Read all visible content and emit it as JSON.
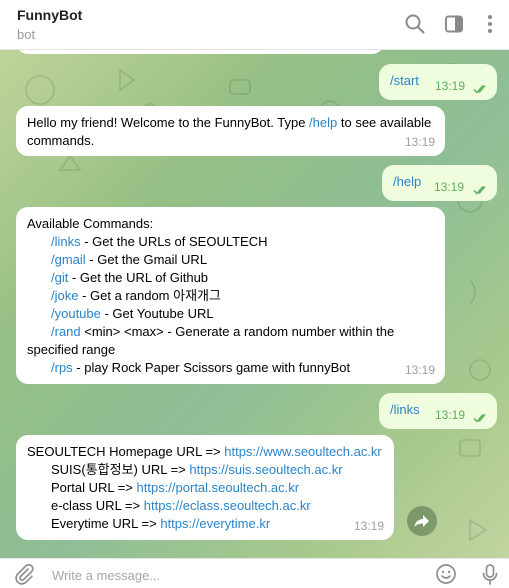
{
  "header": {
    "title": "FunnyBot",
    "status": "bot"
  },
  "messages": [
    {
      "dir": "out",
      "text": "/start",
      "time": "13:19",
      "read": true
    },
    {
      "dir": "in",
      "before": "Hello my friend! Welcome to the FunnyBot. Type ",
      "cmd": "/help",
      "after": " to see available commands.",
      "time": "13:19"
    },
    {
      "dir": "out",
      "text": "/help",
      "time": "13:19",
      "read": true
    },
    {
      "dir": "in",
      "heading": "Available Commands:",
      "lines": [
        {
          "cmd": "/links",
          "desc": " - Get the URLs of SEOULTECH"
        },
        {
          "cmd": "/gmail",
          "desc": " - Get the Gmail URL"
        },
        {
          "cmd": "/git",
          "desc": " - Get the URL of Github"
        },
        {
          "cmd": "/joke",
          "desc": " - Get a random 아재개그"
        },
        {
          "cmd": "/youtube",
          "desc": " - Get Youtube URL"
        },
        {
          "cmd": "/rand",
          "desc": " <min> <max> - Generate a random number within the"
        },
        {
          "cmd": "",
          "desc": "specified range"
        },
        {
          "cmd": "/rps",
          "desc": " - play Rock Paper Scissors game with funnyBot"
        }
      ],
      "time": "13:19"
    },
    {
      "dir": "out",
      "text": "/links",
      "time": "13:19",
      "read": true
    },
    {
      "dir": "in",
      "urls": [
        {
          "label": "SEOULTECH Homepage URL => ",
          "url": "https://www.seoultech.ac.kr"
        },
        {
          "label": "SUIS(통합정보) URL => ",
          "url": "https://suis.seoultech.ac.kr"
        },
        {
          "label": "Portal URL => ",
          "url": "https://portal.seoultech.ac.kr"
        },
        {
          "label": "e-class URL => ",
          "url": "https://eclass.seoultech.ac.kr"
        },
        {
          "label": "Everytime URL => ",
          "url": "https://everytime.kr"
        }
      ],
      "time": "13:19"
    }
  ],
  "composer": {
    "placeholder": "Write a message..."
  },
  "icons": {
    "search": "search-icon",
    "sidebar": "sidebar-toggle-icon",
    "more": "more-vertical-icon",
    "attach": "paperclip-icon",
    "emoji": "emoji-icon",
    "mic": "microphone-icon",
    "forward": "forward-arrow-icon"
  },
  "colors": {
    "link": "#2a84c8",
    "outgoing_bubble": "#effdde",
    "incoming_bubble": "#ffffff",
    "read_ticks": "#5daf5c"
  }
}
